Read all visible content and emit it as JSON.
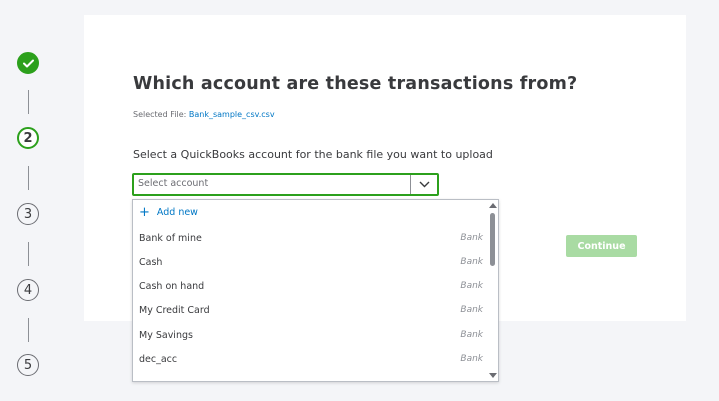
{
  "stepper": {
    "steps": [
      {
        "label": "",
        "state": "done"
      },
      {
        "label": "2",
        "state": "current"
      },
      {
        "label": "3",
        "state": "pending"
      },
      {
        "label": "4",
        "state": "pending"
      },
      {
        "label": "5",
        "state": "pending"
      }
    ]
  },
  "main": {
    "title": "Which account are these transactions from?",
    "selected_file_label": "Selected File:",
    "selected_file_name": "Bank_sample_csv.csv",
    "prompt": "Select a QuickBooks account for the bank file you want to upload",
    "select": {
      "placeholder": "Select account"
    },
    "dropdown": {
      "add_new": "Add new",
      "options": [
        {
          "name": "Bank of mine",
          "type": "Bank"
        },
        {
          "name": "Cash",
          "type": "Bank"
        },
        {
          "name": "Cash on hand",
          "type": "Bank"
        },
        {
          "name": "My Credit Card",
          "type": "Bank"
        },
        {
          "name": "My Savings",
          "type": "Bank"
        },
        {
          "name": "dec_acc",
          "type": "Bank"
        }
      ]
    },
    "continue_label": "Continue"
  },
  "colors": {
    "accent_green": "#2ca01c",
    "link_blue": "#0077c5",
    "disabled_button": "#a9dba3"
  }
}
